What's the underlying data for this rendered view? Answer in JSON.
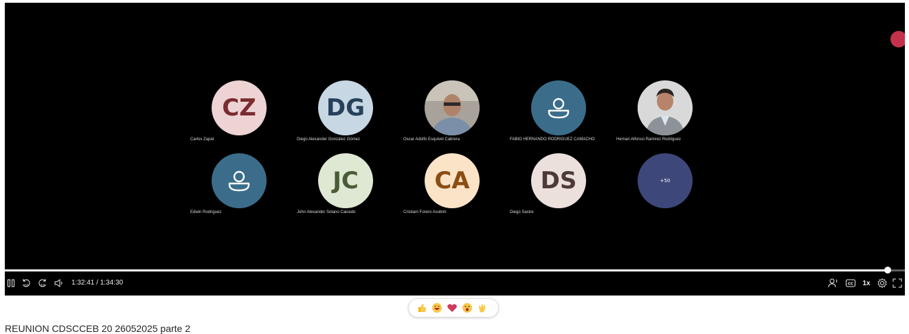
{
  "meeting": {
    "title": "REUNION CDSCCEB 20 26052025 parte 2"
  },
  "participants": [
    {
      "name": "Carlos Zapat",
      "initials": "CZ",
      "avatar": "initials"
    },
    {
      "name": "Diego Alexander González Gómez",
      "initials": "DG",
      "avatar": "initials"
    },
    {
      "name": "Oscar Adolfo Esquivel Cabrera",
      "avatar": "photo"
    },
    {
      "name": "FABIO HERNANDO RODRIGUEZ CAMACHO",
      "avatar": "person-icon"
    },
    {
      "name": "Hernan Alfonso Ramirez Rodriguez",
      "avatar": "photo"
    },
    {
      "name": "Edwin Rodriguez",
      "avatar": "person-icon"
    },
    {
      "name": "John Alexander Solano Caicedo",
      "initials": "JC",
      "avatar": "initials"
    },
    {
      "name": "Cristiam Forero Asobim",
      "initials": "CA",
      "avatar": "initials"
    },
    {
      "name": "Diego Sastre",
      "initials": "DS",
      "avatar": "initials"
    }
  ],
  "overflow": {
    "label": "+50"
  },
  "player": {
    "current_time": "1:32:41",
    "duration": "1:34:30",
    "time_display": "1:32:41 / 1:34:30",
    "progress": 0.9807,
    "speed_label": "1x",
    "skip_back_label": "10",
    "skip_forward_label": "10"
  },
  "reactions": [
    "like",
    "laugh",
    "heart",
    "surprised",
    "applause"
  ],
  "colors": {
    "recording": "#c4314b",
    "more_avatar": "#3e4779",
    "person_avatar": "#3b6d8b"
  }
}
